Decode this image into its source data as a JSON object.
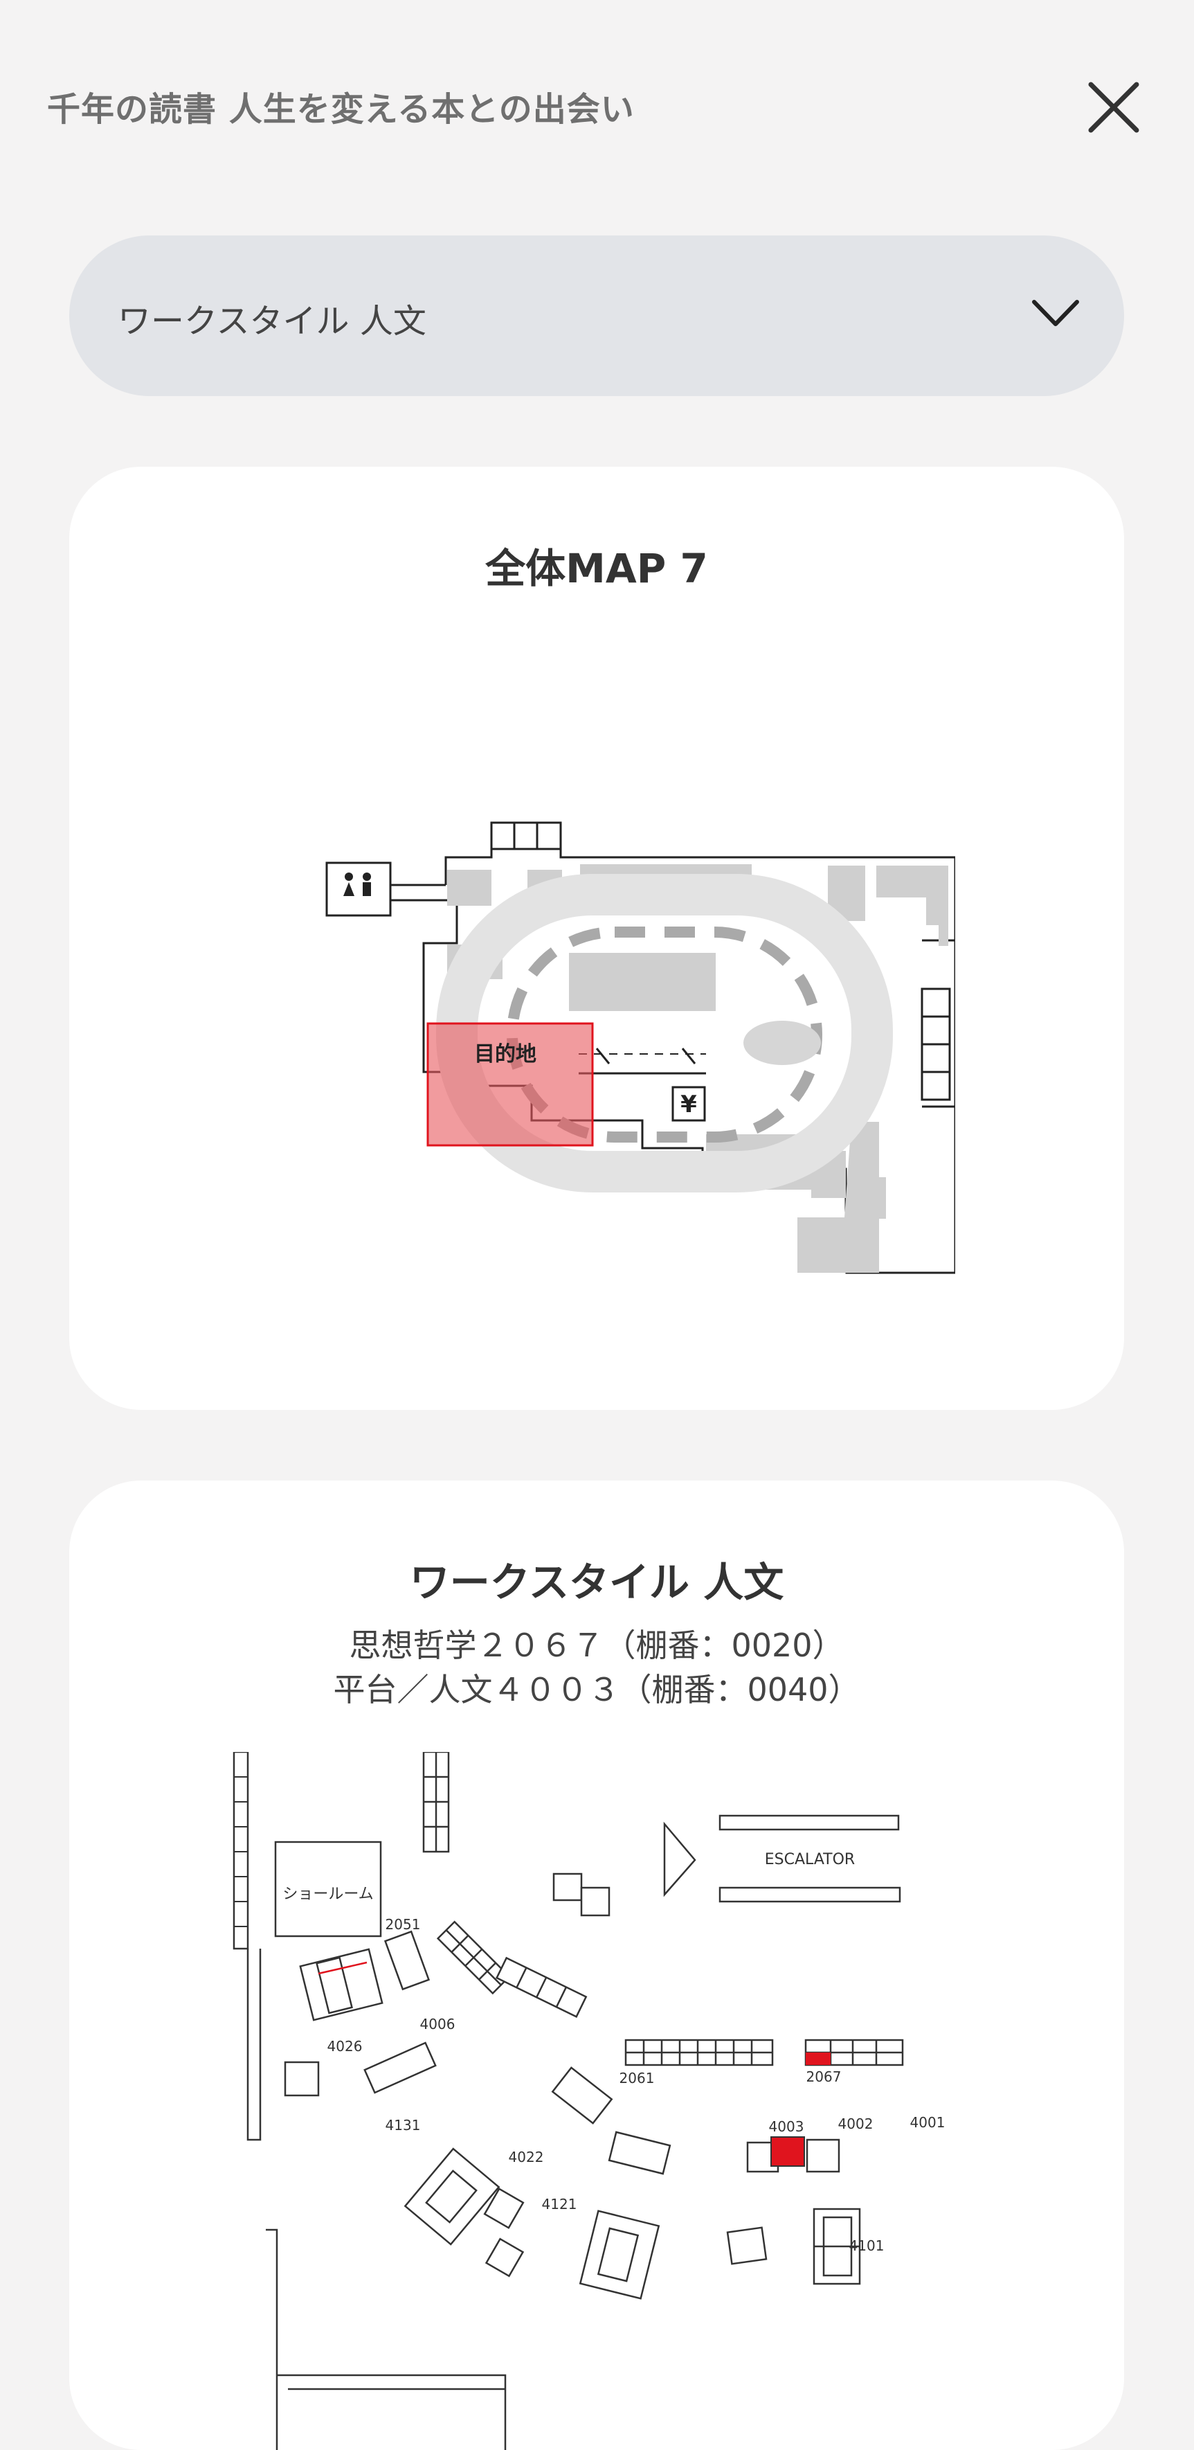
{
  "header": {
    "title": "千年の読書 人生を変える本との出会い",
    "close_icon": "close-icon"
  },
  "category_select": {
    "selected": "ワークスタイル 人文",
    "chevron_icon": "chevron-down-icon"
  },
  "overall_map": {
    "title": "全体MAP 7",
    "destination_label": "目的地",
    "destination_color": "#e8595e",
    "yen_symbol": "¥"
  },
  "floor_map": {
    "title": "ワークスタイル 人文",
    "shelves": [
      "思想哲学２０６７（棚番：0020）",
      "平台／人文４００３（棚番：0040）"
    ],
    "labels": {
      "showroom": "ショールーム",
      "escalator": "ESCALATOR",
      "n2051": "2051",
      "n4006": "4006",
      "n4026": "4026",
      "n2061": "2061",
      "n2067": "2067",
      "n4131": "4131",
      "n4022": "4022",
      "n4003": "4003",
      "n4002": "4002",
      "n4001": "4001",
      "n4121": "4121",
      "n4101": "4101"
    },
    "highlight_color": "#e0141e"
  }
}
